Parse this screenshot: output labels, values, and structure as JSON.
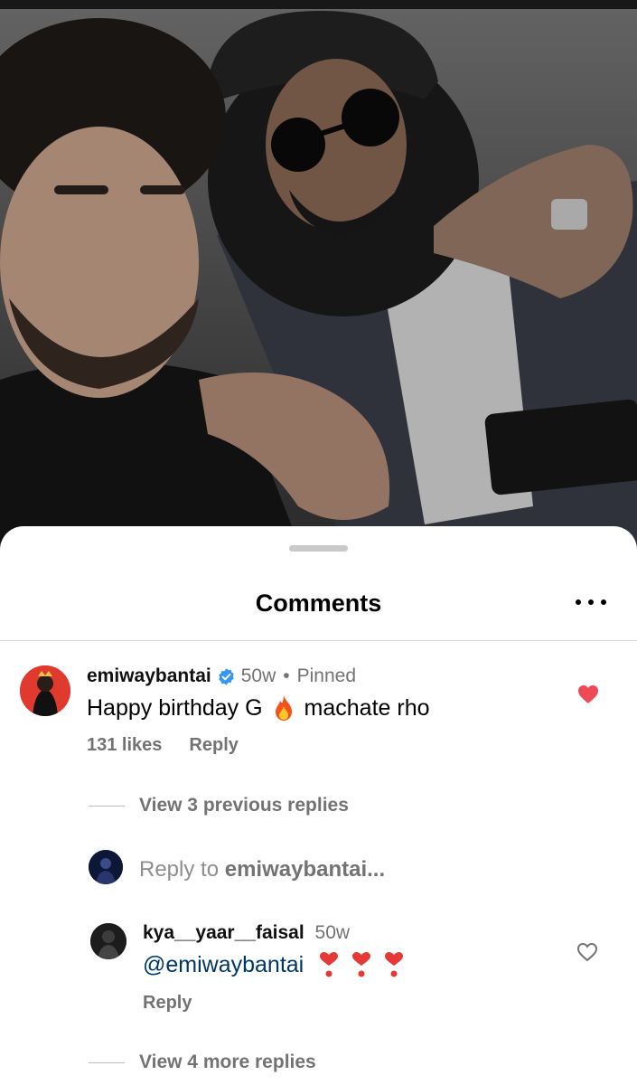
{
  "sheet": {
    "title": "Comments",
    "more_icon": "ellipsis-icon"
  },
  "comments": [
    {
      "username": "emiwaybantai",
      "verified": true,
      "age": "50w",
      "separator": "•",
      "pinned": "Pinned",
      "text_before": "Happy birthday G",
      "emoji": "fire-emoji",
      "text_after": "machate rho",
      "likes": "131 likes",
      "reply_label": "Reply",
      "liked": true,
      "avatar_color": "#e03a2f"
    },
    {
      "username": "kya__yaar__faisal",
      "age": "50w",
      "mention": "@emiwaybantai",
      "emoji": "red-heart-exclamation-emoji ×3",
      "reply_label": "Reply",
      "liked": false
    }
  ],
  "view_previous": "View 3 previous replies",
  "reply_prompt": {
    "prefix": "Reply to",
    "target": "emiwaybantai..."
  },
  "view_more": "View 4 more replies",
  "colors": {
    "like_red": "#ed4956",
    "mention_blue": "#00376b",
    "muted": "#737373"
  }
}
